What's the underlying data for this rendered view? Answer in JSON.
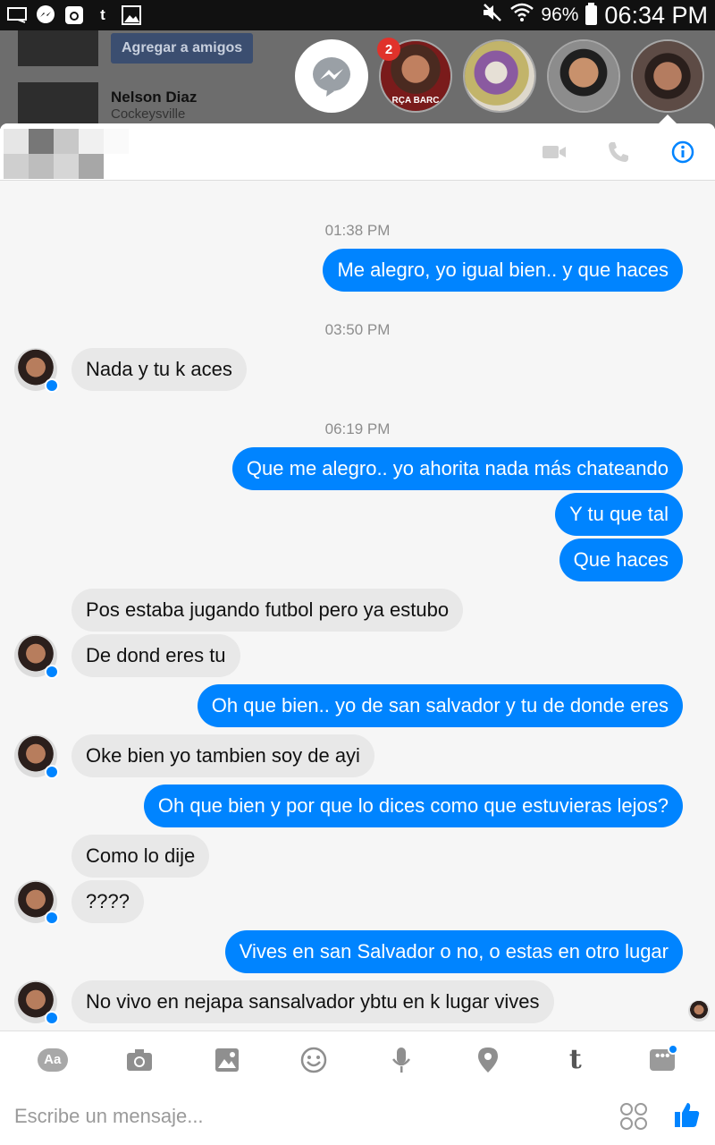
{
  "status_bar": {
    "battery": "96%",
    "time": "06:34 PM",
    "icons": [
      "cast-icon",
      "messenger-icon",
      "instagram-icon",
      "tumblr-icon",
      "image-icon",
      "mute-icon",
      "wifi-icon",
      "battery-icon"
    ]
  },
  "background": {
    "add_friend_label": "Agregar a amigos",
    "person_name": "Nelson Diaz",
    "person_location": "Cockeysville"
  },
  "chat_heads": {
    "unread_badge": "2",
    "head1_caption": "RÇA BARC"
  },
  "header": {
    "icons": [
      "video-call-icon",
      "phone-icon",
      "info-icon"
    ],
    "accent": "#0084ff"
  },
  "messages": [
    {
      "kind": "timestamp",
      "text": "01:38 PM"
    },
    {
      "kind": "out",
      "text": "Me alegro, yo igual bien.. y que haces"
    },
    {
      "kind": "timestamp",
      "text": "03:50 PM"
    },
    {
      "kind": "in",
      "text": "Nada y tu k aces"
    },
    {
      "kind": "timestamp",
      "text": "06:19 PM"
    },
    {
      "kind": "out",
      "text": "Que me alegro.. yo ahorita nada más chateando"
    },
    {
      "kind": "out",
      "text": "Y tu que tal"
    },
    {
      "kind": "out",
      "text": "Que haces"
    },
    {
      "kind": "in",
      "text": "Pos estaba jugando futbol pero ya estubo"
    },
    {
      "kind": "in",
      "text": "De dond eres tu"
    },
    {
      "kind": "out",
      "text": "Oh que bien.. yo de san salvador y tu de donde eres"
    },
    {
      "kind": "in",
      "text": "Oke bien yo tambien soy de ayi"
    },
    {
      "kind": "out",
      "text": "Oh que bien y por que lo dices como que estuvieras lejos?"
    },
    {
      "kind": "in",
      "text": "Como lo dije"
    },
    {
      "kind": "in",
      "text": "????"
    },
    {
      "kind": "out",
      "text": "Vives en san Salvador o no, o estas en otro lugar"
    },
    {
      "kind": "in",
      "text": "No vivo en nejapa sansalvador ybtu en k lugar vives"
    }
  ],
  "composer": {
    "aa_label": "Aa",
    "tumblr_label": "t",
    "more_label": "•••",
    "placeholder": "Escribe un mensaje...",
    "icons": [
      "text-style-icon",
      "camera-icon",
      "gallery-icon",
      "emoji-icon",
      "microphone-icon",
      "location-icon",
      "tumblr-icon",
      "more-icon",
      "stickers-icon",
      "like-icon"
    ]
  }
}
